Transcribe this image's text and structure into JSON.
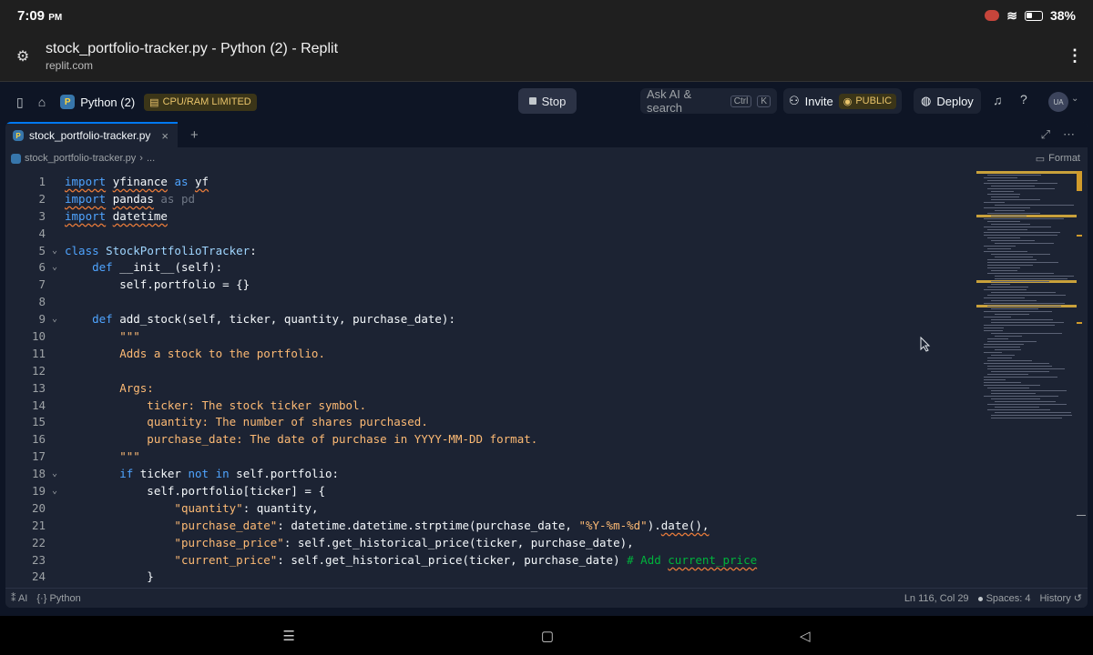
{
  "status": {
    "time": "7:09",
    "ampm": "PM",
    "battery": "38%"
  },
  "browser": {
    "page_title": "stock_portfolio-tracker.py - Python (2) - Replit",
    "domain": "replit.com"
  },
  "topbar": {
    "repl_name": "Python (2)",
    "limit_badge": "CPU/RAM LIMITED",
    "stop_label": "Stop",
    "search_label": "Ask AI & search",
    "kbd_ctrl": "Ctrl",
    "kbd_k": "K",
    "invite_label": "Invite",
    "public_label": "PUBLIC",
    "deploy_label": "Deploy",
    "avatar_initials": "UA"
  },
  "editor": {
    "tab_label": "stock_portfolio-tracker.py",
    "breadcrumb_file": "stock_portfolio-tracker.py",
    "breadcrumb_more": "...",
    "format_label": "Format",
    "lines": [
      "1",
      "2",
      "3",
      "4",
      "5",
      "6",
      "7",
      "8",
      "9",
      "10",
      "11",
      "12",
      "13",
      "14",
      "15",
      "16",
      "17",
      "18",
      "19",
      "20",
      "21",
      "22",
      "23",
      "24"
    ]
  },
  "footer": {
    "ai_label": "AI",
    "lang_label": "Python",
    "position": "Ln 116, Col 29",
    "spaces": "Spaces: 4",
    "history": "History"
  }
}
